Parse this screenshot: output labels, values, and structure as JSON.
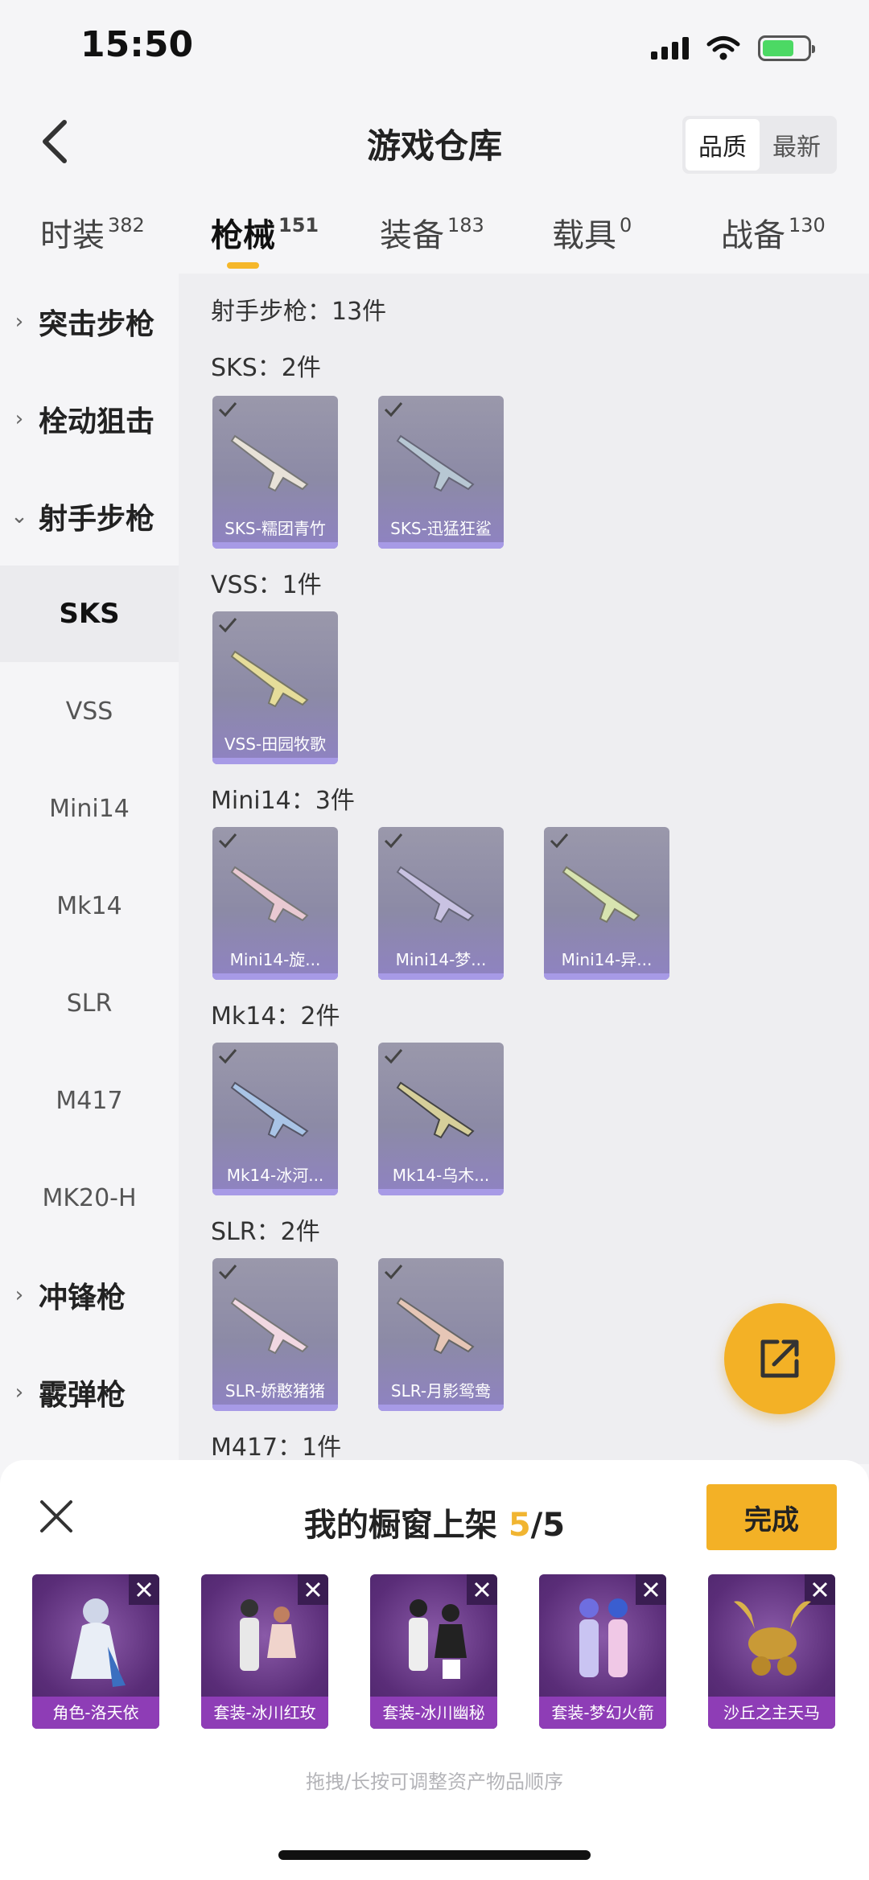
{
  "status": {
    "time": "15:50"
  },
  "header": {
    "title": "游戏仓库",
    "sort": [
      "品质",
      "最新"
    ]
  },
  "tabs": [
    {
      "label": "时装",
      "count": "382"
    },
    {
      "label": "枪械",
      "count": "151"
    },
    {
      "label": "装备",
      "count": "183"
    },
    {
      "label": "载具",
      "count": "0"
    },
    {
      "label": "战备",
      "count": "130"
    }
  ],
  "sidebar": {
    "categories": [
      "突击步枪",
      "栓动狙击",
      "射手步枪",
      "冲锋枪",
      "霰弹枪"
    ],
    "subs": [
      "SKS",
      "VSS",
      "Mini14",
      "Mk14",
      "SLR",
      "M417",
      "MK20-H"
    ]
  },
  "content": {
    "section_title": "射手步枪：13件",
    "groups": [
      {
        "title": "SKS：2件",
        "items": [
          "SKS-糯团青竹",
          "SKS-迅猛狂鲨"
        ]
      },
      {
        "title": "VSS：1件",
        "items": [
          "VSS-田园牧歌"
        ]
      },
      {
        "title": "Mini14：3件",
        "items": [
          "Mini14-旋...",
          "Mini14-梦...",
          "Mini14-异..."
        ]
      },
      {
        "title": "Mk14：2件",
        "items": [
          "Mk14-冰河...",
          "Mk14-乌木..."
        ]
      },
      {
        "title": "SLR：2件",
        "items": [
          "SLR-娇憨猪猪",
          "SLR-月影鸳鸯"
        ]
      },
      {
        "title": "M417：1件",
        "items": []
      }
    ]
  },
  "showcase": {
    "title_prefix": "我的橱窗上架 ",
    "current": "5",
    "total": "/5",
    "done_label": "完成",
    "slots": [
      "角色-洛天依",
      "套装-冰川红玫",
      "套装-冰川幽秘",
      "套装-梦幻火箭",
      "沙丘之主天马"
    ],
    "hint": "拖拽/长按可调整资产物品顺序"
  },
  "colors": {
    "accent": "#f3b126",
    "slot_purple": "#8e3db6"
  }
}
